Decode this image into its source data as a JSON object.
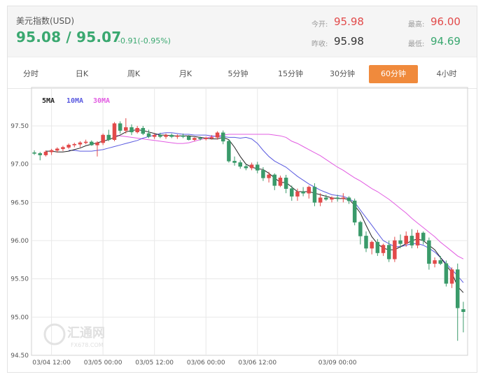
{
  "quote": {
    "name": "美元指数(USD)",
    "price": "95.08 / 95.07",
    "arrow": "↓",
    "change": "-0.91(-0.95%)",
    "open_label": "今开:",
    "open": "95.98",
    "prev_label": "昨收:",
    "prev": "95.98",
    "high_label": "最高:",
    "high": "96.00",
    "low_label": "最低:",
    "low": "94.69"
  },
  "tabs": [
    "分时",
    "日K",
    "周K",
    "月K",
    "5分钟",
    "15分钟",
    "30分钟",
    "60分钟",
    "4小时"
  ],
  "active_tab": "60分钟",
  "watermark": {
    "main": "汇通网",
    "sub": "FX678.COM"
  },
  "colors": {
    "up": "#e24a4a",
    "down": "#3a9a6a",
    "ma5": "#222222",
    "ma10": "#5a5ae0",
    "ma30": "#e25ce2",
    "accent": "#f08a3c",
    "price_green": "#3aa870",
    "stat_red": "#e24a4a"
  },
  "chart_data": {
    "type": "candlestick",
    "ylim": [
      94.5,
      97.5
    ],
    "yticks": [
      "97.50",
      "97.00",
      "96.50",
      "96.00",
      "95.50",
      "95.00",
      "94.50"
    ],
    "xticks": [
      "03/04 12:00",
      "03/05 00:00",
      "03/05 12:00",
      "03/06 00:00",
      "03/06 12:00",
      "03/09 00:00"
    ],
    "legend": [
      "5MA",
      "10MA",
      "30MA"
    ],
    "grid": true,
    "candles": [
      [
        97.15,
        97.18,
        97.12,
        97.14
      ],
      [
        97.14,
        97.16,
        97.05,
        97.12
      ],
      [
        97.12,
        97.18,
        97.1,
        97.16
      ],
      [
        97.16,
        97.2,
        97.12,
        97.18
      ],
      [
        97.18,
        97.22,
        97.15,
        97.2
      ],
      [
        97.2,
        97.24,
        97.17,
        97.22
      ],
      [
        97.22,
        97.27,
        97.2,
        97.25
      ],
      [
        97.25,
        97.28,
        97.22,
        97.26
      ],
      [
        97.26,
        97.3,
        97.22,
        97.28
      ],
      [
        97.28,
        97.32,
        97.26,
        97.29
      ],
      [
        97.29,
        97.31,
        97.24,
        97.25
      ],
      [
        97.25,
        97.3,
        97.1,
        97.28
      ],
      [
        97.28,
        97.4,
        97.25,
        97.38
      ],
      [
        97.38,
        97.45,
        97.3,
        97.32
      ],
      [
        97.32,
        97.55,
        97.3,
        97.53
      ],
      [
        97.53,
        97.56,
        97.4,
        97.44
      ],
      [
        97.44,
        97.6,
        97.4,
        97.48
      ],
      [
        97.48,
        97.52,
        97.38,
        97.42
      ],
      [
        97.42,
        97.5,
        97.4,
        97.47
      ],
      [
        97.47,
        97.5,
        97.38,
        97.4
      ],
      [
        97.4,
        97.45,
        97.34,
        97.36
      ],
      [
        97.36,
        97.4,
        97.33,
        97.38
      ],
      [
        97.38,
        97.41,
        97.34,
        97.36
      ],
      [
        97.36,
        97.4,
        97.33,
        97.38
      ],
      [
        97.38,
        97.4,
        97.34,
        97.36
      ],
      [
        97.36,
        97.39,
        97.33,
        97.37
      ],
      [
        97.37,
        97.4,
        97.34,
        97.36
      ],
      [
        97.36,
        97.38,
        97.31,
        97.32
      ],
      [
        97.32,
        97.35,
        97.3,
        97.34
      ],
      [
        97.34,
        97.36,
        97.31,
        97.33
      ],
      [
        97.33,
        97.36,
        97.31,
        97.34
      ],
      [
        97.34,
        97.38,
        97.32,
        97.35
      ],
      [
        97.35,
        97.43,
        97.32,
        97.41
      ],
      [
        97.41,
        97.44,
        97.26,
        97.3
      ],
      [
        97.3,
        97.32,
        97.02,
        97.04
      ],
      [
        97.04,
        97.1,
        96.98,
        97.02
      ],
      [
        97.02,
        97.05,
        96.94,
        96.97
      ],
      [
        96.97,
        97.0,
        96.92,
        96.95
      ],
      [
        96.95,
        97.02,
        96.92,
        96.99
      ],
      [
        96.99,
        97.03,
        96.88,
        96.92
      ],
      [
        96.92,
        96.96,
        96.78,
        96.82
      ],
      [
        96.82,
        96.9,
        96.76,
        96.86
      ],
      [
        96.86,
        96.88,
        96.66,
        96.72
      ],
      [
        96.72,
        96.85,
        96.7,
        96.82
      ],
      [
        96.82,
        96.86,
        96.62,
        96.68
      ],
      [
        96.68,
        96.72,
        96.52,
        96.58
      ],
      [
        96.58,
        96.68,
        96.52,
        96.64
      ],
      [
        96.64,
        96.7,
        96.58,
        96.62
      ],
      [
        96.62,
        96.72,
        96.55,
        96.7
      ],
      [
        96.7,
        96.75,
        96.45,
        96.5
      ],
      [
        96.5,
        96.62,
        96.45,
        96.56
      ],
      [
        96.56,
        96.6,
        96.52,
        96.54
      ],
      [
        96.54,
        96.58,
        96.5,
        96.56
      ],
      [
        96.56,
        96.6,
        96.51,
        96.55
      ],
      [
        96.55,
        96.62,
        96.5,
        96.56
      ],
      [
        96.56,
        96.58,
        96.48,
        96.52
      ],
      [
        96.52,
        96.55,
        96.2,
        96.24
      ],
      [
        96.24,
        96.26,
        95.95,
        96.06
      ],
      [
        96.06,
        96.12,
        95.85,
        95.9
      ],
      [
        95.9,
        96.0,
        95.82,
        95.98
      ],
      [
        95.98,
        96.02,
        95.8,
        95.84
      ],
      [
        95.84,
        95.96,
        95.8,
        95.94
      ],
      [
        95.94,
        96.0,
        95.72,
        95.76
      ],
      [
        95.76,
        96.05,
        95.72,
        96.0
      ],
      [
        96.0,
        96.08,
        95.9,
        95.96
      ],
      [
        95.96,
        96.12,
        95.92,
        96.06
      ],
      [
        96.06,
        96.15,
        95.9,
        95.94
      ],
      [
        95.94,
        96.14,
        95.9,
        96.1
      ],
      [
        96.1,
        96.12,
        95.95,
        96.0
      ],
      [
        96.0,
        96.04,
        95.62,
        95.7
      ],
      [
        95.7,
        95.78,
        95.65,
        95.74
      ],
      [
        95.74,
        95.8,
        95.68,
        95.7
      ],
      [
        95.7,
        95.74,
        95.4,
        95.44
      ],
      [
        95.44,
        95.65,
        95.38,
        95.62
      ],
      [
        95.62,
        95.7,
        94.69,
        95.12
      ],
      [
        95.1,
        95.2,
        94.8,
        95.07
      ]
    ],
    "ma5": [
      97.17,
      97.17,
      97.16,
      97.16,
      97.17,
      97.19,
      97.21,
      97.24,
      97.26,
      97.28,
      97.3,
      97.32,
      97.35,
      97.38,
      97.42,
      97.44,
      97.45,
      97.44,
      97.42,
      97.4,
      97.38,
      97.38,
      97.37,
      97.37,
      97.37,
      97.37,
      97.36,
      97.35,
      97.34,
      97.33,
      97.33,
      97.35,
      97.32,
      97.22,
      97.1,
      97.0,
      96.96,
      96.94,
      96.93,
      96.88,
      96.82,
      96.76,
      96.76,
      96.7,
      96.64,
      96.64,
      96.64,
      96.62,
      96.6,
      96.58,
      96.56,
      96.55,
      96.55,
      96.54,
      96.46,
      96.36,
      96.2,
      96.05,
      95.96,
      95.9,
      95.88,
      95.88,
      95.92,
      95.96,
      96.0,
      96.02,
      96.0,
      95.94,
      95.88,
      95.78,
      95.68,
      95.58,
      95.4,
      95.32
    ],
    "ma10": [
      97.18,
      97.18,
      97.17,
      97.17,
      97.17,
      97.18,
      97.19,
      97.21,
      97.23,
      97.25,
      97.27,
      97.29,
      97.31,
      97.34,
      97.36,
      97.38,
      97.4,
      97.41,
      97.41,
      97.4,
      97.39,
      97.39,
      97.38,
      97.38,
      97.38,
      97.37,
      97.36,
      97.36,
      97.35,
      97.35,
      97.34,
      97.35,
      97.33,
      97.27,
      97.18,
      97.1,
      97.04,
      97.0,
      96.96,
      96.9,
      96.84,
      96.79,
      96.74,
      96.7,
      96.66,
      96.63,
      96.6,
      96.59,
      96.58,
      96.55,
      96.5,
      96.4,
      96.3,
      96.2,
      96.1,
      96.0,
      95.96,
      95.92,
      95.92,
      95.94,
      95.96,
      95.96,
      95.94,
      95.9,
      95.85,
      95.78,
      95.7,
      95.62,
      95.54,
      95.45
    ],
    "ma30": [
      97.38,
      97.37,
      97.36,
      97.35,
      97.34,
      97.33,
      97.32,
      97.31,
      97.3,
      97.29,
      97.28,
      97.27,
      97.27,
      97.28,
      97.3,
      97.32,
      97.34,
      97.36,
      97.37,
      97.38,
      97.39,
      97.39,
      97.39,
      97.39,
      97.39,
      97.39,
      97.39,
      97.39,
      97.38,
      97.37,
      97.35,
      97.3,
      97.27,
      97.23,
      97.19,
      97.15,
      97.11,
      97.06,
      97.01,
      96.96,
      96.92,
      96.87,
      96.82,
      96.78,
      96.73,
      96.68,
      96.64,
      96.59,
      96.54,
      96.48,
      96.42,
      96.36,
      96.29,
      96.23,
      96.17,
      96.11,
      96.05,
      95.98,
      95.92,
      95.86,
      95.8,
      95.76
    ]
  }
}
